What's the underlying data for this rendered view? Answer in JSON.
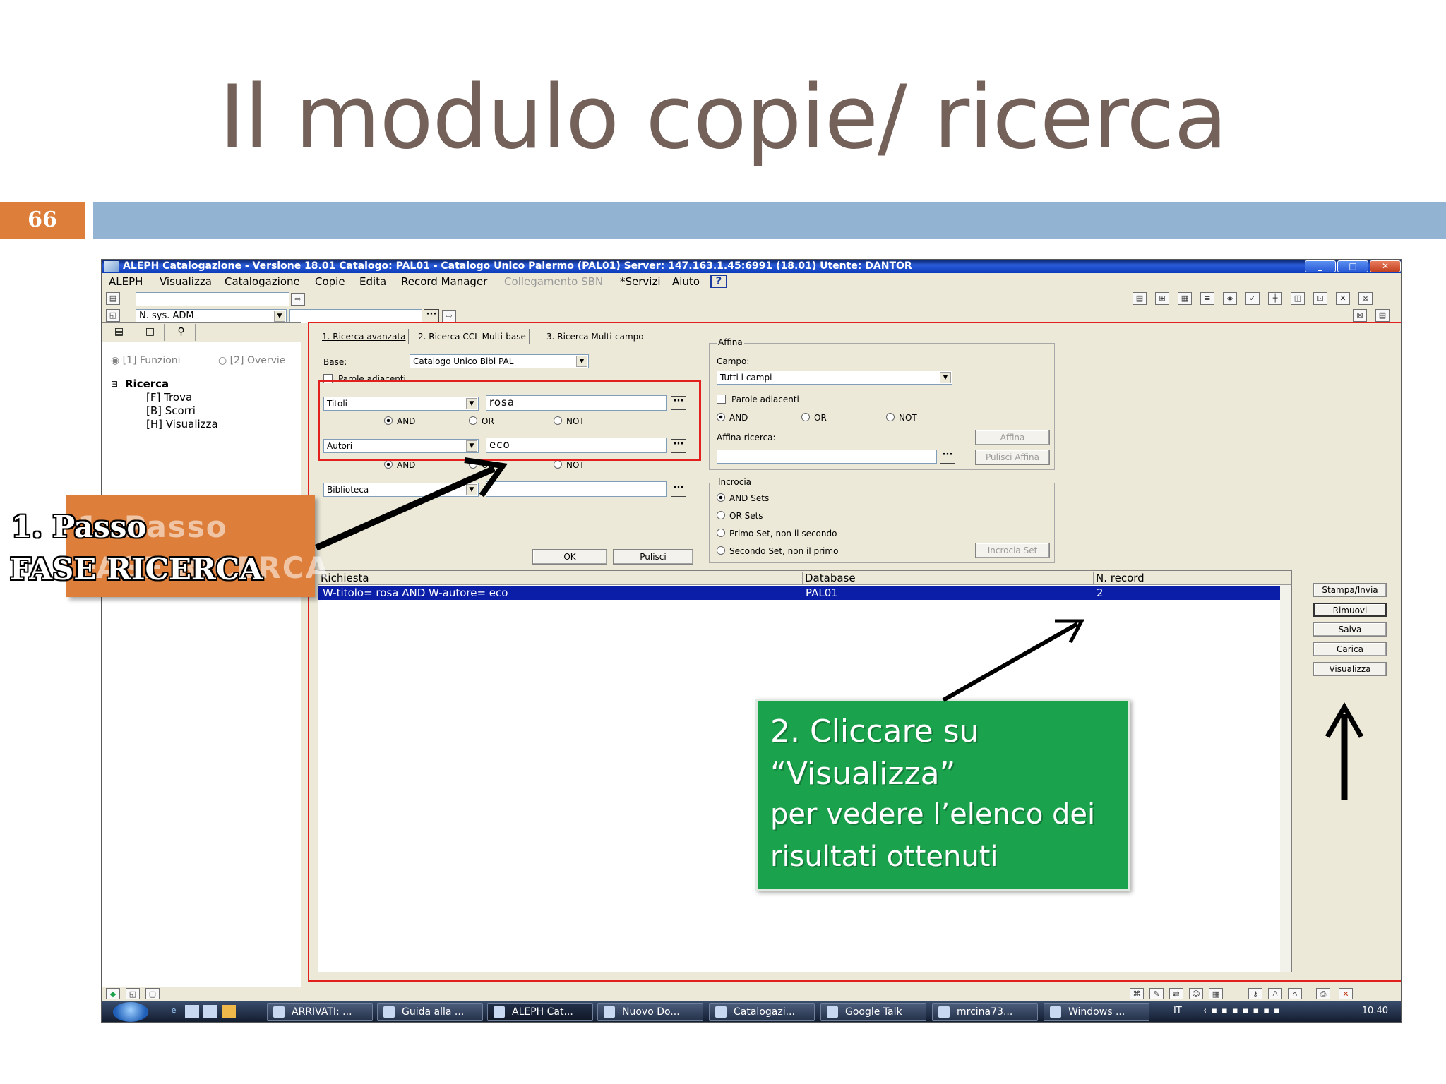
{
  "slide": {
    "title": "Il modulo copie/ ricerca",
    "number": "66"
  },
  "window": {
    "title": "ALEPH Catalogazione - Versione 18.01  Catalogo:  PAL01 - Catalogo Unico Palermo (PAL01)  Server:  147.163.1.45:6991 (18.01)  Utente:  DANTOR",
    "buttons": {
      "minimize": "_",
      "maximize": "□",
      "close": "✕"
    }
  },
  "menu": [
    {
      "label": "ALEPH",
      "disabled": false
    },
    {
      "label": "Visualizza",
      "disabled": false
    },
    {
      "label": "Catalogazione",
      "disabled": false
    },
    {
      "label": "Copie",
      "disabled": false
    },
    {
      "label": "Edita",
      "disabled": false
    },
    {
      "label": "Record Manager",
      "disabled": false
    },
    {
      "label": "Collegamento SBN",
      "disabled": true
    },
    {
      "label": "*Servizi",
      "disabled": false
    },
    {
      "label": "Aiuto",
      "disabled": false
    }
  ],
  "help_label": "?",
  "toolbar": {
    "sys_select": "N. sys. ADM",
    "dots": "···",
    "go": "⇨"
  },
  "left_panel": {
    "radio_funzioni": "[1] Funzioni",
    "radio_overview": "[2] Overvie",
    "tree_root": "Ricerca",
    "tree_items": [
      "[F] Trova",
      "[B] Scorri",
      "[H] Visualizza"
    ],
    "expander": "⊟"
  },
  "tabs": [
    "1. Ricerca avanzata",
    "2. Ricerca CCL Multi-base",
    "3. Ricerca Multi-campo"
  ],
  "search": {
    "base_label": "Base:",
    "base_value": "Catalogo Unico Bibl PAL",
    "parole_adiacenti": "Parole adiacenti",
    "field1": "Titoli",
    "value1": "rosa",
    "field2": "Autori",
    "value2": "eco",
    "field3": "Biblioteca",
    "value3": "",
    "op_and": "AND",
    "op_or": "OR",
    "op_not": "NOT",
    "ok": "OK",
    "pulisci": "Pulisci"
  },
  "affina": {
    "title": "Affina",
    "campo_label": "Campo:",
    "campo_value": "Tutti i campi",
    "parole_adiacenti": "Parole adiacenti",
    "op_and": "AND",
    "op_or": "OR",
    "op_not": "NOT",
    "ricerca_label": "Affina ricerca:",
    "affina_btn": "Affina",
    "pulisci_btn": "Pulisci Affina"
  },
  "incrocia": {
    "title": "Incrocia",
    "options": [
      "AND Sets",
      "OR Sets",
      "Primo Set, non il secondo",
      "Secondo Set, non il primo"
    ],
    "button": "Incrocia Set"
  },
  "results": {
    "headers": [
      "Richiesta",
      "Database",
      "N. record"
    ],
    "rows": [
      {
        "query": "W-titolo= rosa AND W-autore= eco",
        "database": "PAL01",
        "count": "2"
      }
    ]
  },
  "side_buttons": [
    "Stampa/Invia",
    "Rimuovi",
    "Salva",
    "Carica",
    "Visualizza"
  ],
  "taskbar": {
    "items": [
      "ARRIVATI: ...",
      "Guida alla ...",
      "ALEPH Cat...",
      "Nuovo Do...",
      "Catalogazi...",
      "Google Talk",
      "mrcina73...",
      "Windows ..."
    ],
    "lang": "IT",
    "clock": "10.40"
  },
  "callout_orange": {
    "ghost_line1": "1. Passo",
    "ghost_line2": "FASE RICERCA",
    "line1": "1.  Passo",
    "line2": "FASE RICERCA"
  },
  "callout_green": {
    "lines": [
      "2. Cliccare su",
      "“Visualizza”",
      "per vedere l’elenco dei",
      "risultati ottenuti"
    ]
  },
  "colors": {
    "title": "#73615a",
    "orange": "#dd7f3b",
    "band": "#93b3d3",
    "green": "#1aa24c",
    "red_highlight": "#e2211f",
    "selection": "#0a1ea8"
  }
}
